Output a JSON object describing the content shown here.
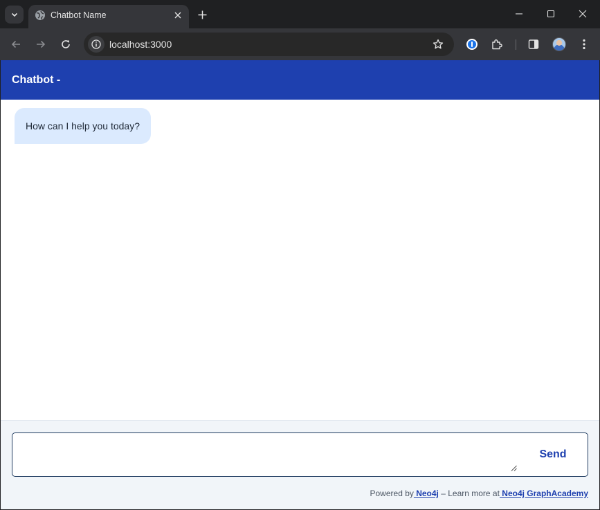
{
  "browser": {
    "tab_title": "Chatbot Name",
    "url": "localhost:3000"
  },
  "app": {
    "title": "Chatbot -",
    "messages": [
      {
        "role": "assistant",
        "text": "How can I help you today?"
      }
    ],
    "composer": {
      "value": "",
      "send_label": "Send"
    },
    "footer": {
      "powered_prefix": "Powered by",
      "neo4j_link": " Neo4j",
      "learn_more": " – Learn more at",
      "academy_link": " Neo4j GraphAcademy"
    }
  },
  "colors": {
    "header_bg": "#1e40af",
    "bubble_bg": "#dbeafe",
    "footer_bg": "#f1f5f9",
    "accent": "#1e40af"
  },
  "icons": [
    "tab-search-icon",
    "globe-icon",
    "close-icon",
    "plus-icon",
    "minimize-icon",
    "maximize-icon",
    "window-close-icon",
    "back-icon",
    "forward-icon",
    "reload-icon",
    "site-info-icon",
    "star-icon",
    "password-manager-icon",
    "extensions-icon",
    "side-panel-icon",
    "avatar",
    "more-icon"
  ]
}
